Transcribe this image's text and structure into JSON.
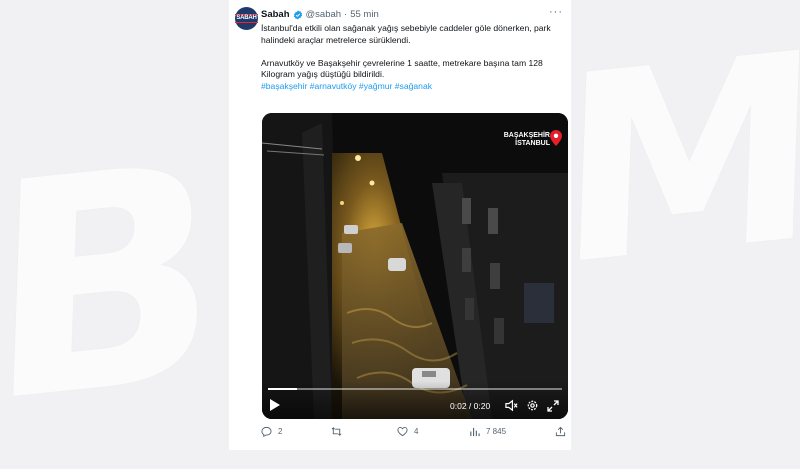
{
  "tweet": {
    "author_name": "Sabah",
    "avatar_text": "SABAH",
    "handle": "@sabah",
    "separator": "·",
    "time": "55 min",
    "text_1": "İstanbul'da etkili olan sağanak yağış sebebiyle caddeler göle dönerken, park halindeki araçlar metrelerce sürüklendi.",
    "text_2": "Arnavutköy ve Başakşehir çevrelerine 1 saatte, metrekare başına tam 128 Kilogram yağış düştüğü bildirildi.",
    "hashtags": "#başakşehir #arnavutköy #yağmur #sağanak"
  },
  "video": {
    "badge_line1": "BAŞAKŞEHİR",
    "badge_line2": "İSTANBUL",
    "time": "0:02 / 0:20",
    "progress": 0.1
  },
  "actions": {
    "replies": "2",
    "retweets": "",
    "likes": "4",
    "views": "7 845"
  },
  "colors": {
    "accent": "#1d9bf0",
    "pin": "#e3202c",
    "muted": "#536471"
  }
}
